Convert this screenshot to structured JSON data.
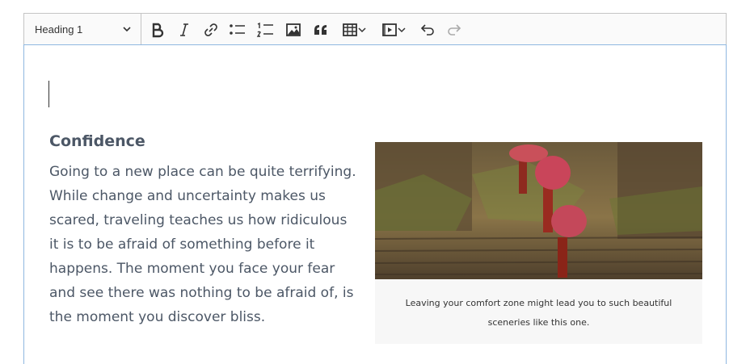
{
  "toolbar": {
    "heading_select": "Heading 1",
    "tools": [
      {
        "name": "bold-button",
        "icon": "bold-icon"
      },
      {
        "name": "italic-button",
        "icon": "italic-icon"
      },
      {
        "name": "link-button",
        "icon": "link-icon"
      },
      {
        "name": "bulleted-list-button",
        "icon": "bulleted-list-icon"
      },
      {
        "name": "numbered-list-button",
        "icon": "numbered-list-icon"
      },
      {
        "name": "insert-image-button",
        "icon": "image-icon"
      },
      {
        "name": "block-quote-button",
        "icon": "quote-icon"
      },
      {
        "name": "insert-table-button",
        "icon": "table-icon"
      },
      {
        "name": "insert-media-button",
        "icon": "media-icon"
      },
      {
        "name": "undo-button",
        "icon": "undo-icon"
      },
      {
        "name": "redo-button",
        "icon": "redo-icon"
      }
    ]
  },
  "content": {
    "heading": "Confidence",
    "paragraph": "Going to a new place can be quite terrifying. While change and uncertainty makes us scared, traveling teaches us how ridiculous it is to be afraid of something before it happens. The moment you face your fear and see there was nothing to be afraid of, is the moment you discover bliss.",
    "figure_caption": "Leaving your comfort zone might lead you to such beautiful sceneries like this one."
  },
  "colors": {
    "toolbar_bg": "#fafafa",
    "border": "#c4c4c4",
    "focus_border": "#8fb7e0",
    "text": "#4c5766"
  }
}
